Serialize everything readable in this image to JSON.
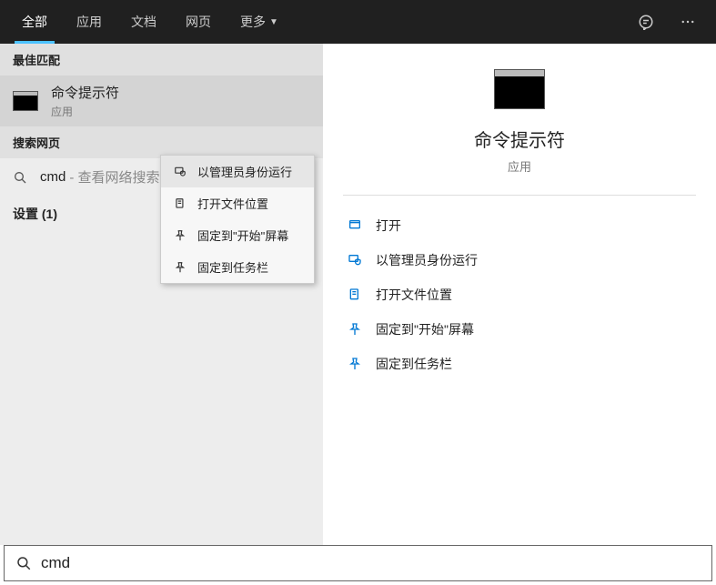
{
  "tabs": {
    "all": "全部",
    "apps": "应用",
    "docs": "文档",
    "web": "网页",
    "more": "更多"
  },
  "left": {
    "best_match": "最佳匹配",
    "result_title": "命令提示符",
    "result_sub": "应用",
    "search_web": "搜索网页",
    "web_query": "cmd",
    "web_hint": "- 查看网络搜索结",
    "settings": "设置 (1)"
  },
  "context_menu": {
    "run_admin": "以管理员身份运行",
    "open_location": "打开文件位置",
    "pin_start": "固定到\"开始\"屏幕",
    "pin_taskbar": "固定到任务栏"
  },
  "detail": {
    "title": "命令提示符",
    "sub": "应用",
    "actions": {
      "open": "打开",
      "run_admin": "以管理员身份运行",
      "open_location": "打开文件位置",
      "pin_start": "固定到\"开始\"屏幕",
      "pin_taskbar": "固定到任务栏"
    }
  },
  "search": {
    "value": "cmd"
  }
}
